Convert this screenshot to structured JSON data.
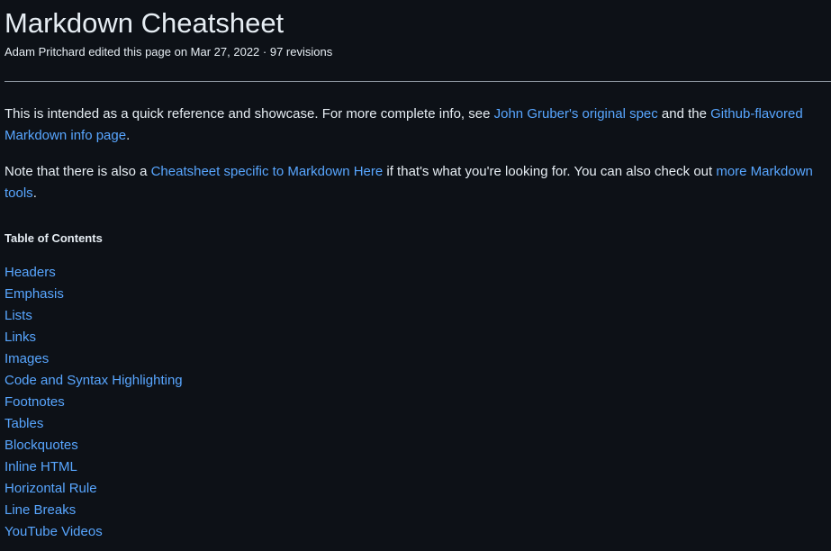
{
  "page": {
    "title": "Markdown Cheatsheet",
    "meta": "Adam Pritchard edited this page on Mar 27, 2022 · 97 revisions"
  },
  "intro": {
    "p1_text1": "This is intended as a quick reference and showcase. For more complete info, see ",
    "p1_link1": "John Gruber's original spec",
    "p1_text2": " and the ",
    "p1_link2": "Github-flavored Markdown info page",
    "p1_text3": ".",
    "p2_text1": "Note that there is also a ",
    "p2_link1": "Cheatsheet specific to Markdown Here",
    "p2_text2": " if that's what you're looking for. You can also check out ",
    "p2_link2": "more Markdown tools",
    "p2_text3": "."
  },
  "toc": {
    "heading": "Table of Contents",
    "items": [
      "Headers",
      "Emphasis",
      "Lists",
      "Links",
      "Images",
      "Code and Syntax Highlighting",
      "Footnotes",
      "Tables",
      "Blockquotes",
      "Inline HTML",
      "Horizontal Rule",
      "Line Breaks",
      "YouTube Videos"
    ]
  },
  "colors": {
    "background": "#0d1117",
    "text": "#e6edf3",
    "link": "#58a6ff"
  }
}
